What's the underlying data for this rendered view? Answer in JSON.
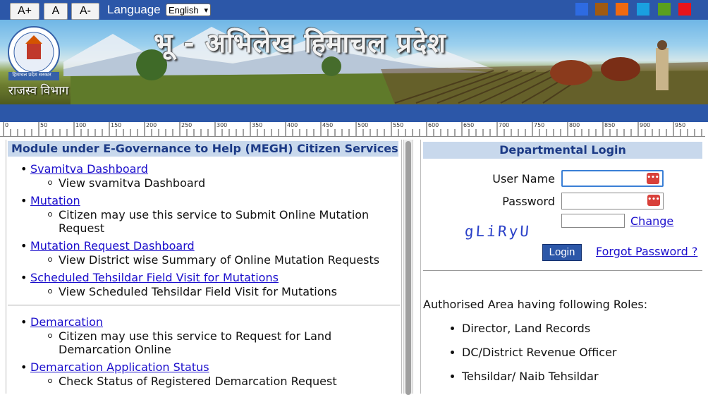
{
  "font_size_controls": {
    "increase": "A+",
    "normal": "A",
    "decrease": "A-"
  },
  "language": {
    "label": "Language",
    "selected": "English"
  },
  "theme_colors": [
    "#2e6be2",
    "#a05a12",
    "#f06a10",
    "#1aa0e0",
    "#5aa01e",
    "#e8141a"
  ],
  "banner": {
    "title": "भू - अभिलेख हिमाचल प्रदेश",
    "department": "राजस्व विभाग",
    "emblem_text": "हिमाचल प्रदेश सरकार"
  },
  "ruler": {
    "labels": [
      "0",
      "50",
      "100",
      "150",
      "200",
      "250",
      "300",
      "350",
      "400",
      "450",
      "500",
      "550",
      "600",
      "650",
      "700",
      "750",
      "800",
      "850",
      "900",
      "950"
    ]
  },
  "left_panel": {
    "heading": "Module under E-Governance to Help (MEGH) Citizen Services",
    "services": [
      {
        "title": "Svamitva Dashboard",
        "desc_lines": [
          "View svamitva Dashboard"
        ]
      },
      {
        "title": "Mutation",
        "desc_lines": [
          "Citizen may use this service to Submit Online Mutation",
          "Request"
        ]
      },
      {
        "title": "Mutation Request Dashboard",
        "desc_lines": [
          "View District wise Summary of Online Mutation Requests"
        ]
      },
      {
        "title": "Scheduled Tehsildar Field Visit for Mutations",
        "desc_lines": [
          "View Scheduled Tehsildar Field Visit for Mutations"
        ]
      },
      {
        "title": "Demarcation",
        "desc_lines": [
          "Citizen may use this service to Request for Land",
          "Demarcation Online"
        ]
      },
      {
        "title": "Demarcation Application Status",
        "desc_lines": [
          "Check Status of Registered Demarcation Request"
        ]
      }
    ]
  },
  "login": {
    "heading": "Departmental Login",
    "username_label": "User Name",
    "password_label": "Password",
    "username_value": "",
    "password_value": "",
    "captcha_text": "gLiRyU",
    "captcha_input_value": "",
    "change_link": "Change",
    "login_button": "Login",
    "forgot_link": "Forgot Password ?"
  },
  "roles": {
    "title": "Authorised Area having following Roles:",
    "items": [
      "Director, Land Records",
      "DC/District Revenue Officer",
      "Tehsildar/ Naib Tehsildar"
    ]
  }
}
